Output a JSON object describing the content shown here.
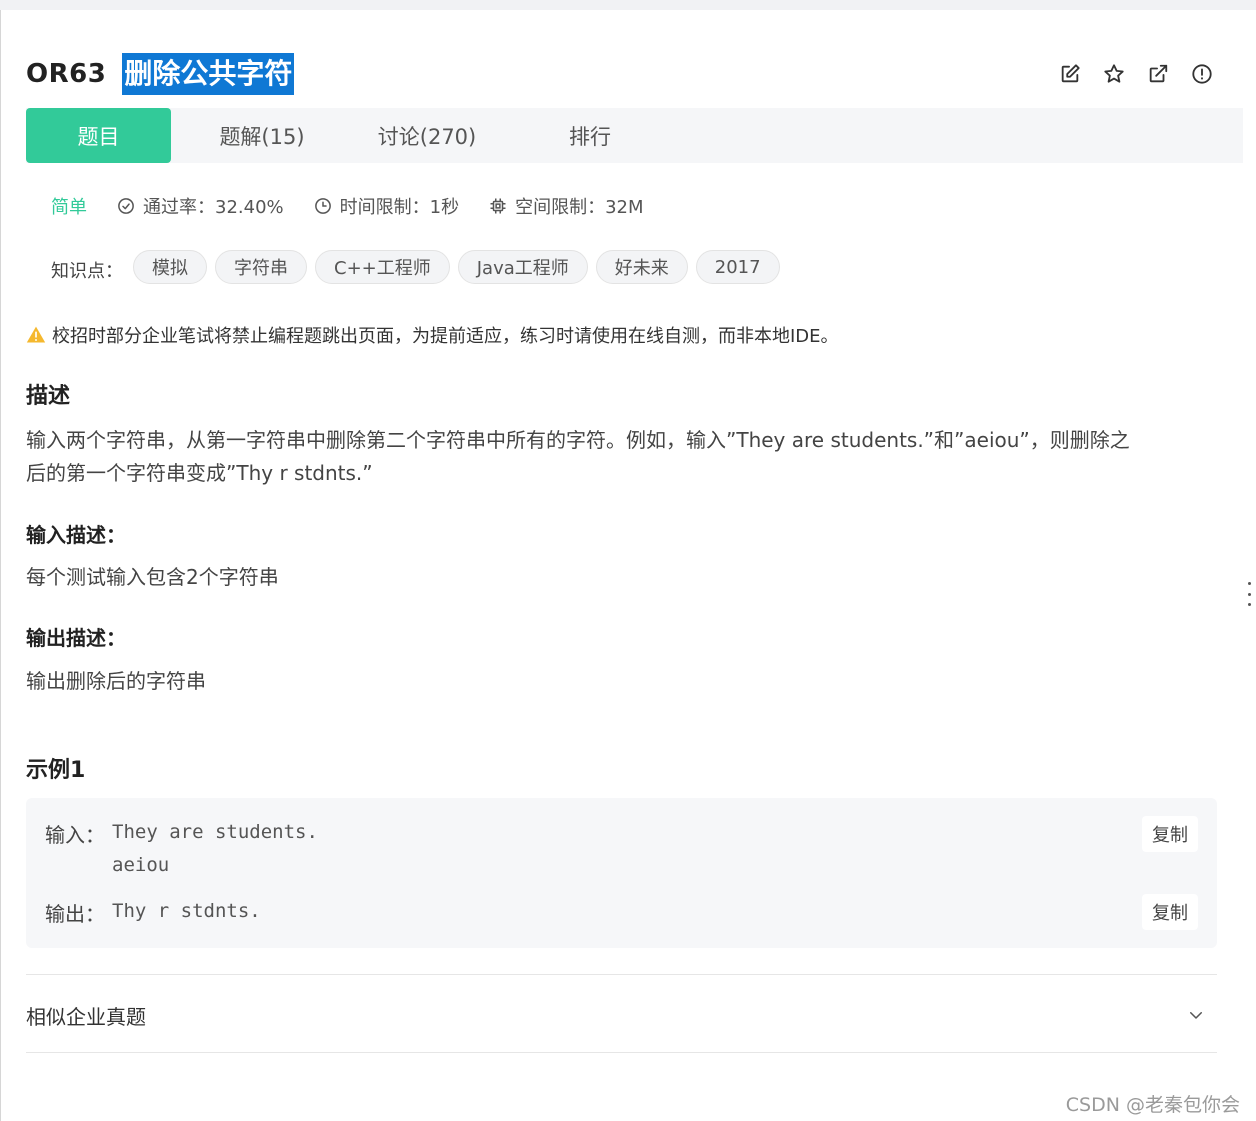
{
  "problem": {
    "id": "OR63",
    "title": "删除公共字符"
  },
  "toolbar_icons": [
    "edit-icon",
    "star-icon",
    "external-link-icon",
    "report-icon"
  ],
  "tabs": [
    {
      "label": "题目",
      "active": true
    },
    {
      "label": "题解(15)",
      "active": false
    },
    {
      "label": "讨论(270)",
      "active": false
    },
    {
      "label": "排行",
      "active": false
    }
  ],
  "meta": {
    "difficulty": "简单",
    "pass_rate": "通过率：32.40%",
    "time_limit": "时间限制：1秒",
    "space_limit": "空间限制：32M"
  },
  "tags": {
    "label": "知识点：",
    "items": [
      "模拟",
      "字符串",
      "C++工程师",
      "Java工程师",
      "好未来",
      "2017"
    ]
  },
  "notice": "校招时部分企业笔试将禁止编程题跳出页面，为提前适应，练习时请使用在线自测，而非本地IDE。",
  "description": {
    "heading": "描述",
    "line1": "输入两个字符串，从第一字符串中删除第二个字符串中所有的字符。例如，输入”They are students.”和”aeiou”，则删除之",
    "line2": "后的第一个字符串变成”Thy r stdnts.”"
  },
  "input_desc": {
    "heading": "输入描述：",
    "text": "每个测试输入包含2个字符串"
  },
  "output_desc": {
    "heading": "输出描述：",
    "text": "输出删除后的字符串"
  },
  "example": {
    "heading": "示例1",
    "input_label": "输入：",
    "input_line1": "They are students.",
    "input_line2": "aeiou",
    "output_label": "输出：",
    "output_line": "Thy r stdnts.",
    "copy_label": "复制"
  },
  "similar": {
    "label": "相似企业真题"
  },
  "watermark": "CSDN @老秦包你会",
  "colors": {
    "accent": "#32ca99",
    "title_highlight": "#0f78d4",
    "warning": "#f5b82e"
  }
}
